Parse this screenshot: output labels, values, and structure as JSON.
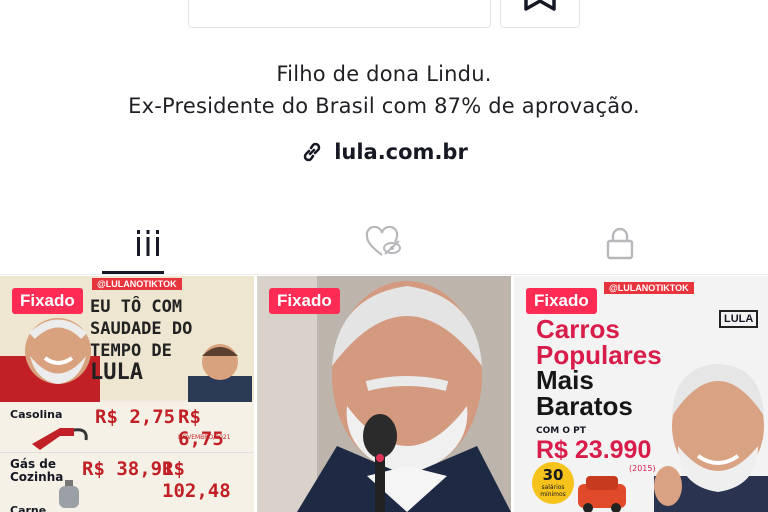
{
  "profile": {
    "bio_line1": "Filho de dona Lindu.",
    "bio_line2": "Ex-Presidente do Brasil com 87% de aprovação.",
    "link": "lula.com.br"
  },
  "tabs": [
    {
      "icon": "grid-icon",
      "active": true
    },
    {
      "icon": "liked-hidden-icon",
      "active": false
    },
    {
      "icon": "lock-icon",
      "active": false
    }
  ],
  "videos": [
    {
      "badge": "Fixado",
      "handle": "@LULANOTIKTOK",
      "headline": [
        "EU TÔ COM",
        "SAUDADE DO",
        "TEMPO DE",
        "LULA"
      ],
      "rows": [
        {
          "label": "Casolina",
          "then": "R$ 2,75",
          "now": "R$ 6,75",
          "date": "NOVEMBRO/2021"
        },
        {
          "label": "Gás de Cozinha",
          "then": "R$ 38,91",
          "now": "R$ 102,48"
        },
        {
          "label": "Carne"
        }
      ]
    },
    {
      "badge": "Fixado"
    },
    {
      "badge": "Fixado",
      "handle": "@LULANOTIKTOK",
      "logo": "LULA",
      "headline": [
        "Carros",
        "Populares"
      ],
      "headline2": [
        "Mais",
        "Baratos"
      ],
      "sub": "COM O PT",
      "price": "R$ 23.990",
      "year": "(2015)",
      "salary_num": "30",
      "salary_text": "salários mínimos"
    }
  ],
  "colors": {
    "accent": "#fe2c55",
    "text": "#161823"
  }
}
